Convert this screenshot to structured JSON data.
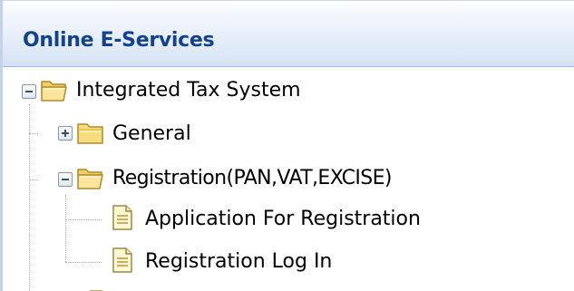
{
  "panel": {
    "title": "Online E-Services"
  },
  "tree": {
    "root": {
      "label": "Integrated Tax System",
      "expanded": true,
      "icon": "folder-open-icon"
    },
    "nodes": [
      {
        "label": "General",
        "expanded": false,
        "icon": "folder-closed-icon"
      },
      {
        "label": "Registration(PAN,VAT,EXCISE)",
        "expanded": true,
        "icon": "folder-open-icon",
        "children": [
          {
            "label": "Application For Registration",
            "icon": "document-icon"
          },
          {
            "label": "Registration Log In",
            "icon": "document-icon"
          }
        ]
      }
    ]
  },
  "colors": {
    "header_text": "#15428b",
    "header_gradient_top": "#ffffff",
    "header_gradient_bottom": "#d2e0f2",
    "folder": "#f5d878",
    "tree_lines": "#a8a8a8"
  }
}
